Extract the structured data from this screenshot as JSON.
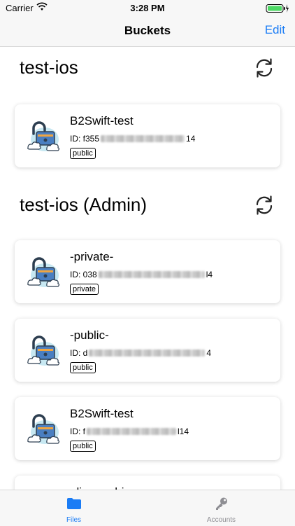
{
  "status_bar": {
    "carrier": "Carrier",
    "time": "3:28 PM"
  },
  "nav": {
    "title": "Buckets",
    "edit_label": "Edit"
  },
  "sections": [
    {
      "title": "test-ios",
      "buckets": [
        {
          "name": "B2Swift-test",
          "id_prefix": "ID: f355",
          "id_suffix": "14",
          "visibility": "public"
        }
      ]
    },
    {
      "title": "test-ios (Admin)",
      "buckets": [
        {
          "name": "-private-",
          "id_prefix": "ID: 038",
          "id_suffix": "l4",
          "visibility": "private"
        },
        {
          "name": "-public-",
          "id_prefix": "ID: d",
          "id_suffix": "4",
          "visibility": "public"
        },
        {
          "name": "B2Swift-test",
          "id_prefix": "ID: f",
          "id_suffix": "l14",
          "visibility": "public"
        },
        {
          "name": "alice-archives",
          "id_prefix": "",
          "id_suffix": "",
          "visibility": ""
        }
      ]
    }
  ],
  "tabs": [
    {
      "label": "Files",
      "icon": "folder-icon",
      "active": true
    },
    {
      "label": "Accounts",
      "icon": "key-icon",
      "active": false
    }
  ],
  "colors": {
    "accent": "#1a7cf5",
    "inactive": "#8e8e93",
    "card_lock": "#4a7fc1",
    "cloud": "#bfe4ef"
  }
}
